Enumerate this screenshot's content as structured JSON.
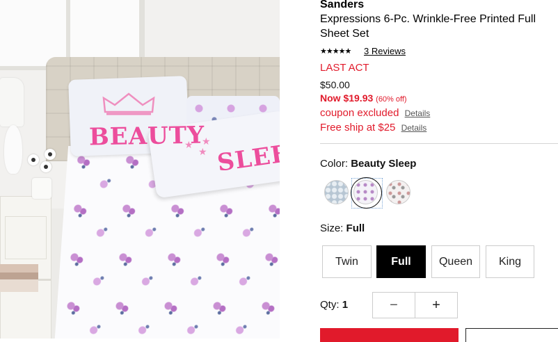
{
  "product": {
    "image_alt": "Product photo: pillows printed BEAUTY and SLEEP on a floral sheet set",
    "pillow_text_1": "BEAUTY",
    "pillow_text_2": "SLEEP",
    "brand": "Sanders",
    "title": "Expressions 6-Pc. Wrinkle-Free Printed Full Sheet Set",
    "rating_stars": "★★★★★",
    "reviews_link": "3 Reviews",
    "badge": "LAST ACT",
    "original_price": "$50.00",
    "now_price": "Now $19.93",
    "discount": "(60% off)",
    "coupon_text": "coupon excluded",
    "coupon_details": "Details",
    "shipping_text": "Free ship at $25",
    "shipping_details": "Details"
  },
  "color": {
    "label": "Color:",
    "selected": "Beauty Sleep",
    "swatches": [
      "light-blue-dot-swatch",
      "beauty-sleep-floral-swatch",
      "multi-dot-swatch"
    ]
  },
  "size": {
    "label": "Size:",
    "selected": "Full",
    "options": [
      "Twin",
      "Full",
      "Queen",
      "King"
    ]
  },
  "quantity": {
    "label": "Qty:",
    "value": "1",
    "minus": "−",
    "plus": "+"
  },
  "colors": {
    "sale_red": "#e11a2b",
    "selected_size_bg": "#000000"
  }
}
